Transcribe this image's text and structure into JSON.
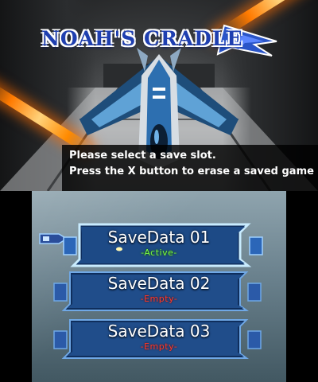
{
  "top_screen": {
    "logo_text": "NOAH'S CRADLE",
    "message_line1": "Please select a save slot.",
    "message_line2": "Press the X button to erase a saved game"
  },
  "save_slots": [
    {
      "title": "SaveData 01",
      "status": "-Active-",
      "state": "active",
      "selected": true
    },
    {
      "title": "SaveData 02",
      "status": "-Empty-",
      "state": "empty",
      "selected": false
    },
    {
      "title": "SaveData 03",
      "status": "-Empty-",
      "state": "empty",
      "selected": false
    }
  ],
  "colors": {
    "active_status": "#7dff4a",
    "empty_status": "#ff3a2a",
    "logo_blue": "#1f3fb0",
    "beam_orange": "#ff7a00"
  },
  "icons": {
    "cursor": "pointer-cursor-icon",
    "logo_emblem": "winged-emblem-icon"
  }
}
